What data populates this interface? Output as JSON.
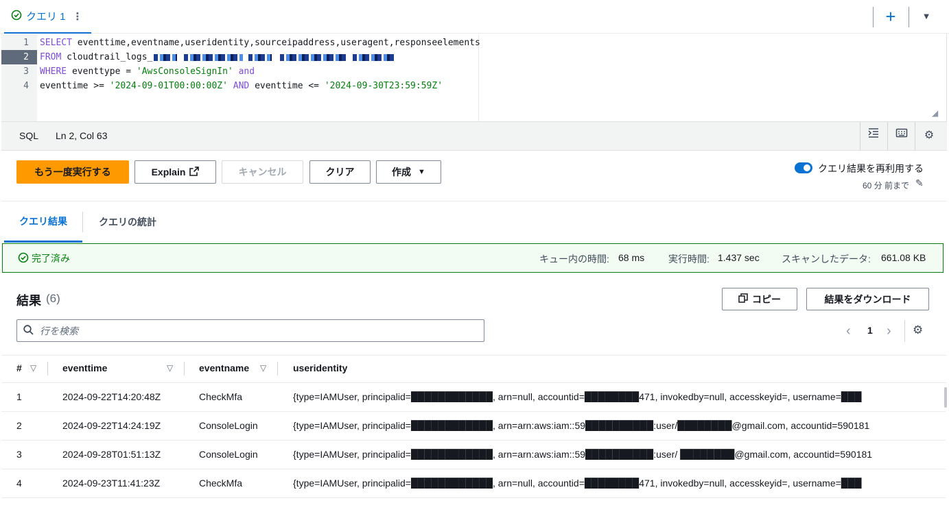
{
  "query_tab": {
    "label": "クエリ 1",
    "menu_icon": "⋮"
  },
  "editor": {
    "lines": [
      {
        "num": "1",
        "kw": "SELECT",
        "rest": " eventtime,eventname,useridentity,sourceipaddress,useragent,responseelements"
      },
      {
        "num": "2",
        "kw": "FROM",
        "rest": " cloudtrail_logs_"
      },
      {
        "num": "3",
        "kw": "WHERE",
        "mid": " eventtype = ",
        "str": "'AwsConsoleSignIn'",
        "kw2": " and"
      },
      {
        "num": "4",
        "pre": "eventtime >= ",
        "str": "'2024-09-01T00:00:00Z'",
        "kw2": " AND",
        "mid": " eventtime <= ",
        "str2": "'2024-09-30T23:59:59Z'"
      }
    ]
  },
  "statusbar": {
    "language": "SQL",
    "position": "Ln 2, Col 63"
  },
  "actions": {
    "run_again": "もう一度実行する",
    "explain": "Explain",
    "cancel": "キャンセル",
    "clear": "クリア",
    "create": "作成",
    "reuse_label": "クエリ結果を再利用する",
    "reuse_sub": "60 分 前まで",
    "reuse_enabled": true
  },
  "result_tabs": {
    "results": "クエリ結果",
    "stats": "クエリの統計"
  },
  "banner": {
    "status": "完了済み",
    "queue_label": "キュー内の時間:",
    "queue_value": "68 ms",
    "exec_label": "実行時間:",
    "exec_value": "1.437 sec",
    "scan_label": "スキャンしたデータ:",
    "scan_value": "661.08 KB",
    "status_color": "#037f0c"
  },
  "results": {
    "title": "結果",
    "count": "(6)",
    "copy": "コピー",
    "download": "結果をダウンロード",
    "search_placeholder": "行を検索",
    "page": "1"
  },
  "table": {
    "columns": [
      "#",
      "eventtime",
      "eventname",
      "useridentity"
    ],
    "rows": [
      {
        "num": "1",
        "eventtime": "2024-09-22T14:20:48Z",
        "eventname": "CheckMfa",
        "useridentity": "{type=IAMUser, principalid=████████████, arn=null, accountid=████████471, invokedby=null, accesskeyid=, username=███"
      },
      {
        "num": "2",
        "eventtime": "2024-09-22T14:24:19Z",
        "eventname": "ConsoleLogin",
        "useridentity": "{type=IAMUser, principalid=████████████, arn=arn:aws:iam::59██████████:user/████████@gmail.com, accountid=590181"
      },
      {
        "num": "3",
        "eventtime": "2024-09-28T01:51:13Z",
        "eventname": "ConsoleLogin",
        "useridentity": "{type=IAMUser, principalid=████████████, arn=arn:aws:iam::59██████████:user/ ████████@gmail.com, accountid=590181"
      },
      {
        "num": "4",
        "eventtime": "2024-09-23T11:41:23Z",
        "eventname": "CheckMfa",
        "useridentity": "{type=IAMUser, principalid=████████████, arn=null, accountid=████████471, invokedby=null, accesskeyid=, username=███"
      }
    ]
  },
  "colors": {
    "accent": "#0972d3",
    "primary_button": "#ff9900",
    "success": "#037f0c"
  }
}
